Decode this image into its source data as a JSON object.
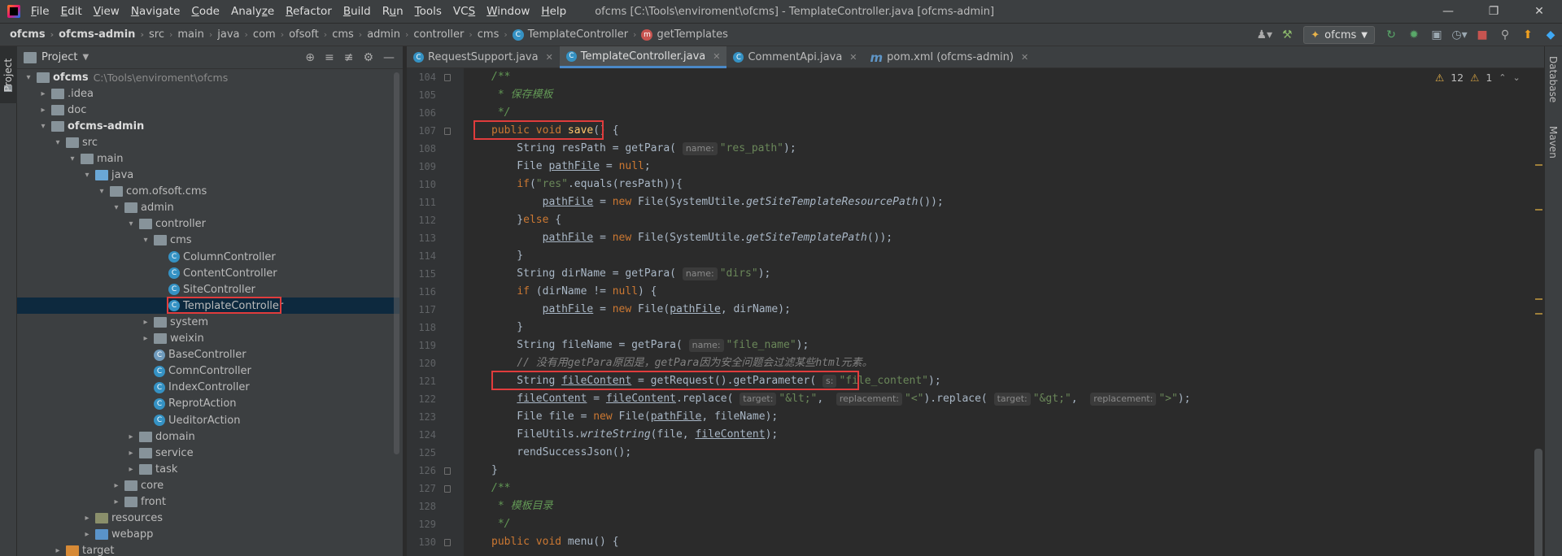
{
  "menubar": {
    "items": [
      {
        "pre": "",
        "u": "F",
        "post": "ile"
      },
      {
        "pre": "",
        "u": "E",
        "post": "dit"
      },
      {
        "pre": "",
        "u": "V",
        "post": "iew"
      },
      {
        "pre": "",
        "u": "N",
        "post": "avigate"
      },
      {
        "pre": "",
        "u": "C",
        "post": "ode"
      },
      {
        "pre": "Analy",
        "u": "z",
        "post": "e"
      },
      {
        "pre": "",
        "u": "R",
        "post": "efactor"
      },
      {
        "pre": "",
        "u": "B",
        "post": "uild"
      },
      {
        "pre": "R",
        "u": "u",
        "post": "n"
      },
      {
        "pre": "",
        "u": "T",
        "post": "ools"
      },
      {
        "pre": "VC",
        "u": "S",
        "post": ""
      },
      {
        "pre": "",
        "u": "W",
        "post": "indow"
      },
      {
        "pre": "",
        "u": "H",
        "post": "elp"
      }
    ],
    "window_title": "ofcms [C:\\Tools\\enviroment\\ofcms] - TemplateController.java [ofcms-admin]",
    "minimize": "—",
    "restore": "❐",
    "close": "✕"
  },
  "navbar": {
    "crumbs": [
      "ofcms",
      "ofcms-admin",
      "src",
      "main",
      "java",
      "com",
      "ofsoft",
      "cms",
      "admin",
      "controller",
      "cms",
      "TemplateController",
      "getTemplates"
    ],
    "run_config": "ofcms"
  },
  "left_stripe": {
    "project_tab": "Project"
  },
  "project": {
    "title": "Project",
    "tree": [
      {
        "label": "ofcms",
        "path": "C:\\Tools\\enviroment\\ofcms",
        "depth": 0,
        "arrow": "▾",
        "icon": "folder",
        "bold": true
      },
      {
        "label": ".idea",
        "depth": 1,
        "arrow": "▸",
        "icon": "folder"
      },
      {
        "label": "doc",
        "depth": 1,
        "arrow": "▸",
        "icon": "folder"
      },
      {
        "label": "ofcms-admin",
        "depth": 1,
        "arrow": "▾",
        "icon": "folder",
        "bold": true
      },
      {
        "label": "src",
        "depth": 2,
        "arrow": "▾",
        "icon": "folder"
      },
      {
        "label": "main",
        "depth": 3,
        "arrow": "▾",
        "icon": "folder"
      },
      {
        "label": "java",
        "depth": 4,
        "arrow": "▾",
        "icon": "folder-src"
      },
      {
        "label": "com.ofsoft.cms",
        "depth": 5,
        "arrow": "▾",
        "icon": "folder"
      },
      {
        "label": "admin",
        "depth": 6,
        "arrow": "▾",
        "icon": "folder"
      },
      {
        "label": "controller",
        "depth": 7,
        "arrow": "▾",
        "icon": "folder"
      },
      {
        "label": "cms",
        "depth": 8,
        "arrow": "▾",
        "icon": "folder"
      },
      {
        "label": "ColumnController",
        "depth": 9,
        "arrow": "",
        "icon": "class"
      },
      {
        "label": "ContentController",
        "depth": 9,
        "arrow": "",
        "icon": "class"
      },
      {
        "label": "SiteController",
        "depth": 9,
        "arrow": "",
        "icon": "class"
      },
      {
        "label": "TemplateController",
        "depth": 9,
        "arrow": "",
        "icon": "class",
        "selected": true
      },
      {
        "label": "system",
        "depth": 8,
        "arrow": "▸",
        "icon": "folder"
      },
      {
        "label": "weixin",
        "depth": 8,
        "arrow": "▸",
        "icon": "folder"
      },
      {
        "label": "BaseController",
        "depth": 8,
        "arrow": "",
        "icon": "aclass"
      },
      {
        "label": "ComnController",
        "depth": 8,
        "arrow": "",
        "icon": "class"
      },
      {
        "label": "IndexController",
        "depth": 8,
        "arrow": "",
        "icon": "class"
      },
      {
        "label": "ReprotAction",
        "depth": 8,
        "arrow": "",
        "icon": "class"
      },
      {
        "label": "UeditorAction",
        "depth": 8,
        "arrow": "",
        "icon": "class"
      },
      {
        "label": "domain",
        "depth": 7,
        "arrow": "▸",
        "icon": "folder"
      },
      {
        "label": "service",
        "depth": 7,
        "arrow": "▸",
        "icon": "folder"
      },
      {
        "label": "task",
        "depth": 7,
        "arrow": "▸",
        "icon": "folder"
      },
      {
        "label": "core",
        "depth": 6,
        "arrow": "▸",
        "icon": "folder"
      },
      {
        "label": "front",
        "depth": 6,
        "arrow": "▸",
        "icon": "folder"
      },
      {
        "label": "resources",
        "depth": 4,
        "arrow": "▸",
        "icon": "folder-res"
      },
      {
        "label": "webapp",
        "depth": 4,
        "arrow": "▸",
        "icon": "folder-blue"
      },
      {
        "label": "target",
        "depth": 2,
        "arrow": "▸",
        "icon": "folder-orange"
      }
    ]
  },
  "editor": {
    "tabs": [
      {
        "label": "RequestSupport.java",
        "icon": "C",
        "active": false
      },
      {
        "label": "TemplateController.java",
        "icon": "C",
        "active": true
      },
      {
        "label": "CommentApi.java",
        "icon": "C",
        "active": false
      },
      {
        "label": "pom.xml (ofcms-admin)",
        "icon": "m",
        "active": false
      }
    ],
    "inspections": {
      "warnings": "12",
      "weak": "1"
    },
    "line_numbers": [
      "104",
      "105",
      "106",
      "107",
      "108",
      "109",
      "110",
      "111",
      "112",
      "113",
      "114",
      "115",
      "116",
      "117",
      "118",
      "119",
      "120",
      "121",
      "122",
      "123",
      "124",
      "125",
      "126",
      "127",
      "128",
      "129",
      "130"
    ]
  },
  "right_stripe": {
    "tabs": [
      "Database",
      "Maven"
    ]
  },
  "colors": {
    "highlight": "#e03c3c",
    "keyword": "#cc7832",
    "string": "#6a8759"
  }
}
